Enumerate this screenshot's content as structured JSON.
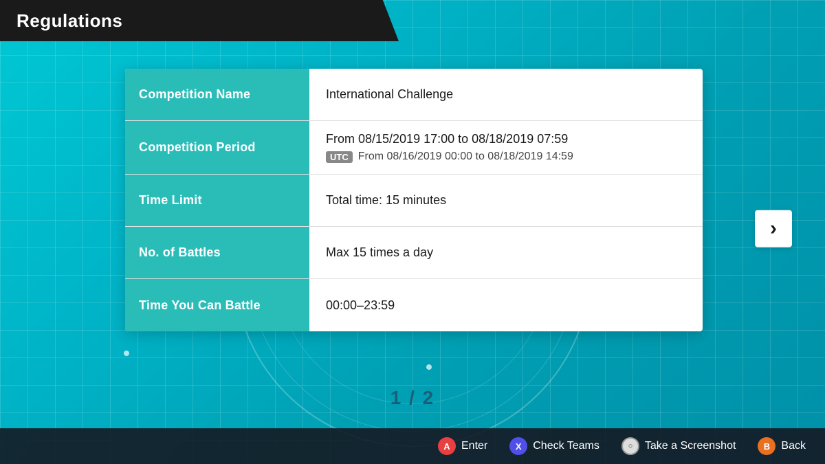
{
  "title": "Regulations",
  "rows": [
    {
      "label": "Competition Name",
      "value": "International Challenge",
      "type": "simple"
    },
    {
      "label": "Competition Period",
      "main": "From 08/15/2019 17:00    to   08/18/2019 07:59",
      "utc_badge": "UTC",
      "utc": "From 08/16/2019 00:00    to   08/18/2019 14:59",
      "type": "period"
    },
    {
      "label": "Time Limit",
      "value": "Total time: 15 minutes",
      "type": "simple"
    },
    {
      "label": "No. of Battles",
      "value": "Max 15 times a day",
      "type": "simple"
    },
    {
      "label": "Time You Can Battle",
      "value": "00:00–23:59",
      "type": "simple"
    }
  ],
  "page_indicator": "1 / 2",
  "next_arrow": "›",
  "bottom_actions": [
    {
      "id": "enter",
      "btn": "A",
      "label": "Enter",
      "btn_class": "btn-a"
    },
    {
      "id": "check_teams",
      "btn": "X",
      "label": "Check Teams",
      "btn_class": "btn-x"
    },
    {
      "id": "screenshot",
      "btn": "O",
      "label": "Take a Screenshot",
      "btn_class": "btn-o"
    },
    {
      "id": "back",
      "btn": "B",
      "label": "Back",
      "btn_class": "btn-b"
    }
  ]
}
